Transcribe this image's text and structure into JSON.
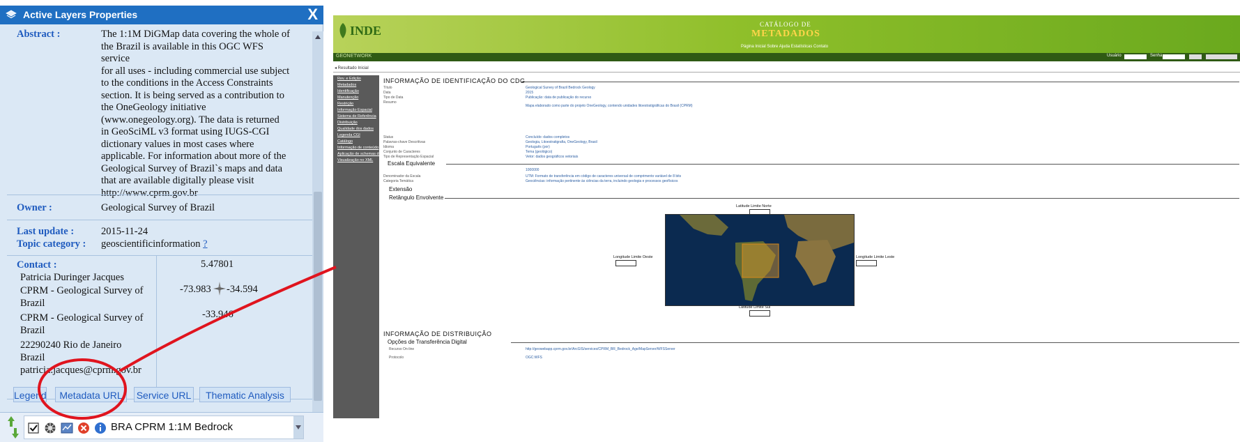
{
  "panel": {
    "title": "Active Layers Properties",
    "close_glyph": "X",
    "abstract_label": "Abstract :",
    "abstract_lines": [
      "The 1:1M DiGMap data covering the whole of",
      "the Brazil is available in this OGC WFS service",
      "for all uses - including commercial use subject",
      "to the conditions in the Access Constraints",
      "section. It is being served as a contribution to",
      "the OneGeology initiative",
      "(www.onegeology.org). The data is returned",
      "in GeoSciML v3 format using IUGS-CGI",
      "dictionary values in most cases where",
      "applicable. For information about more of the",
      "Geological Survey of Brazil`s maps and data",
      "that are available digitally please visit",
      "http://www.cprm.gov.br"
    ],
    "owner_label": "Owner :",
    "owner_value": "Geological Survey of Brazil",
    "last_update_label": "Last update :",
    "last_update_value": "2015-11-24",
    "topic_label": "Topic category :",
    "topic_value": "geoscientificinformation",
    "topic_help": "?",
    "contact_label": "Contact :",
    "contact_lines": [
      "Patricia Duringer Jacques",
      "CPRM - Geological Survey of",
      "Brazil",
      "CPRM - Geological Survey of",
      "Brazil",
      "22290240 Rio de Janeiro",
      "Brazil",
      "patricia.jacques@cprm.gov.br"
    ],
    "coords": {
      "north": "5.47801",
      "west": "-73.983",
      "east": "-34.594",
      "south": "-33.946"
    },
    "tabs": [
      "Legend",
      "Metadata URL",
      "Service URL",
      "Thematic Analysis"
    ],
    "layer_name": "BRA CPRM 1:1M Bedrock"
  },
  "metadata_page": {
    "logo": "INDE",
    "catalog_line1": "CATÁLOGO DE",
    "catalog_line2": "METADADOS",
    "nav": "Página Inicial   Sobre   Ajuda   Estatísticas   Contato",
    "subbar_left": "GEONETWORK",
    "user_label": "Usuário",
    "pass_label": "Senha",
    "breadcrumb": "◂ Resultado Inicial",
    "side_items": [
      "Rev. e Edição",
      "Metadados",
      "Identificação",
      "Manutenção",
      "Restrição",
      "Informação Espacial",
      "Sistema de Referência",
      "Distribuição",
      "Qualidade dos dados",
      "Legenda CGI",
      "Catálogo",
      "Informação de conteúdo",
      "Aplicação de schemas de informação",
      "Visualização no XML"
    ],
    "sec_identification": "INFORMAÇÃO DE IDENTIFICAÇÃO DO CDG",
    "sec_scale": "Escala Equivalente",
    "sec_extent": "Extensão",
    "sec_bbox": "Retângulo Envolvente",
    "sec_distribution": "INFORMAÇÃO DE DISTRIBUIÇÃO",
    "sec_transfer": "Opções de Transferência Digital",
    "bbox_north_label": "Latitude Limite Norte",
    "bbox_south_label": "Latitude Limite Sul",
    "bbox_west_label": "Longitude Limite Oeste",
    "bbox_east_label": "Longitude Limite Leste",
    "ident_rows": [
      {
        "k": "Título",
        "v": "Geological Survey of Brazil Bedrock Geology"
      },
      {
        "k": "Data",
        "v": "2015"
      },
      {
        "k": "Tipo de Data",
        "v": "Publicação: data de publicação do recurso"
      },
      {
        "k": "Resumo",
        "v": "Mapa elaborado como parte do projeto OneGeology, contendo unidades litoestratigráficas do Brasil (CPRM)"
      }
    ],
    "other_rows": [
      {
        "k": "Status",
        "v": "Concluído: dados completos"
      },
      {
        "k": "Palavras-chave Descritivas",
        "v": "Geologia, Litoestratigrafia, OneGeology, Brasil"
      },
      {
        "k": "Idioma",
        "v": "Português (por)"
      },
      {
        "k": "Conjunto de Caracteres",
        "v": "Tema (geológico)"
      },
      {
        "k": "Tipo de Representação Espacial",
        "v": "Vetor: dados geográficos vetoriais"
      }
    ],
    "scale_value": "1000000",
    "scale_rows": [
      {
        "k": "Denominador da Escala",
        "v": "UTM: Formato de transferência em código de caracteres universal de comprimento variável de 8 bits"
      },
      {
        "k": "Categoria Temática",
        "v": "Geociências: informação pertinente às ciências da terra, incluindo geologia e processos geofísicos"
      }
    ],
    "transfer_rows": [
      {
        "k": "Recurso On-line",
        "v": "http://geowebapp.cprm.gov.br/ArcGIS/services/CPRM_BR_Bedrock_Age/MapServer/WFSServer"
      },
      {
        "k": "Protocolo",
        "v": "OGC:WFS"
      }
    ]
  },
  "colors": {
    "panel_header": "#1f6fc2",
    "panel_bg": "#dbe8f5",
    "label_blue": "#1f5bbf",
    "annotation_red": "#e0141e",
    "banner_green": "#8fbf2a"
  }
}
